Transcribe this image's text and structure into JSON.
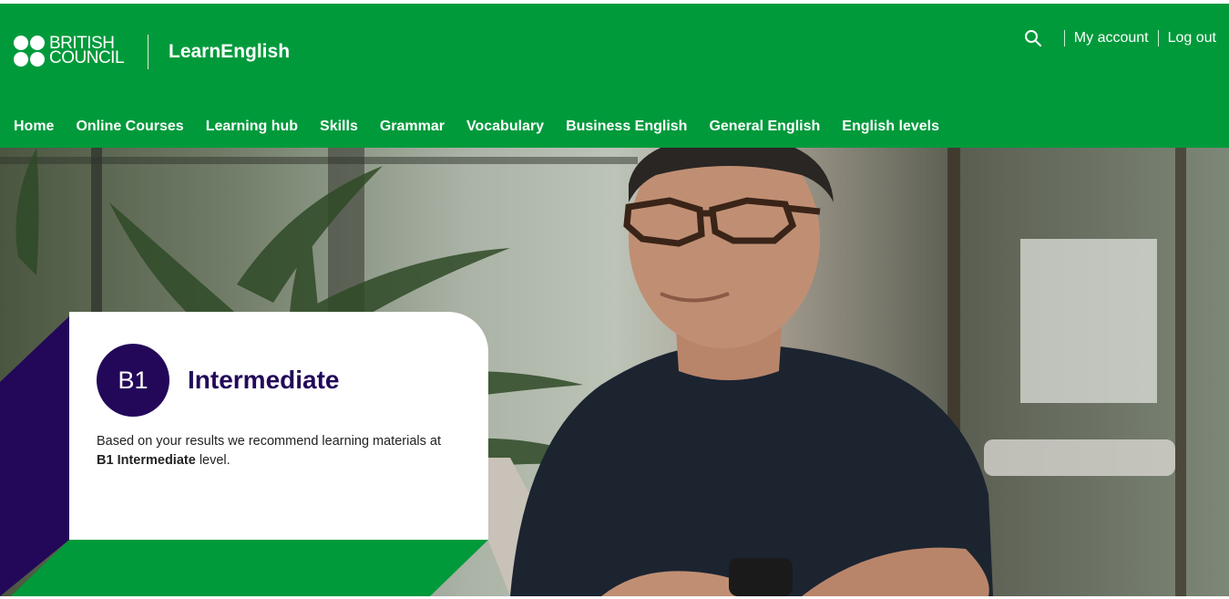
{
  "brand": {
    "logo_line1": "BRITISH",
    "logo_line2": "COUNCIL",
    "site_name": "LearnEnglish"
  },
  "utility": {
    "search_icon": "search-icon",
    "my_account": "My account",
    "log_out": "Log out"
  },
  "nav": {
    "items": [
      {
        "label": "Home"
      },
      {
        "label": "Online Courses"
      },
      {
        "label": "Learning hub"
      },
      {
        "label": "Skills"
      },
      {
        "label": "Grammar"
      },
      {
        "label": "Vocabulary"
      },
      {
        "label": "Business English"
      },
      {
        "label": "General English"
      },
      {
        "label": "English levels"
      }
    ]
  },
  "result": {
    "badge": "B1",
    "title": "Intermediate",
    "desc_prefix": "Based on your results we recommend learning materials at ",
    "desc_bold": "B1 Intermediate",
    "desc_suffix": " level."
  },
  "colors": {
    "brand_green": "#009a3b",
    "accent_purple": "#23085a"
  }
}
